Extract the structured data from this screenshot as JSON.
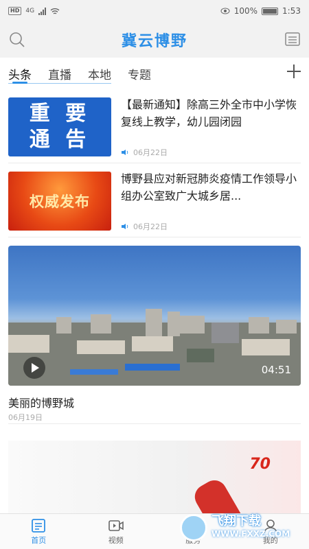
{
  "status": {
    "hd": "HD",
    "network": "4G",
    "battery": "100%",
    "time": "1:53"
  },
  "app": {
    "title": "冀云博野",
    "accent": "#2d8fe6"
  },
  "tabs": [
    {
      "label": "头条",
      "active": true
    },
    {
      "label": "直播",
      "active": false
    },
    {
      "label": "本地",
      "active": false
    },
    {
      "label": "专题",
      "active": false
    }
  ],
  "news": [
    {
      "thumb_line1": "重 要",
      "thumb_line2": "通 告",
      "title": "【最新通知】除高三外全市中小学恢复线上教学，幼儿园闭园",
      "date": "06月22日"
    },
    {
      "thumb_text": "权威发布",
      "title": "博野县应对新冠肺炎疫情工作领导小组办公室致广大城乡居...",
      "date": "06月22日"
    }
  ],
  "video": {
    "duration": "04:51",
    "title": "美丽的博野城",
    "date": "06月19日"
  },
  "promo": {
    "badge": "70"
  },
  "tabbar": [
    {
      "label": "首页",
      "icon": "news-icon",
      "active": true
    },
    {
      "label": "视频",
      "icon": "video-icon",
      "active": false
    },
    {
      "label": "服务",
      "icon": "service-icon",
      "active": false
    },
    {
      "label": "我的",
      "icon": "user-icon",
      "active": false
    }
  ],
  "watermark": {
    "cn": "飞翔下载",
    "url": "WWW.FXXZ.COM"
  }
}
